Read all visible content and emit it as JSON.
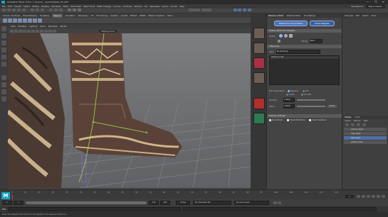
{
  "titlebar": {
    "title": "Autodesk Maya 2019: C:\\Users\\...\\scenes\\boot_fix.mb*",
    "controls": "— ❐ ✕"
  },
  "menubar": {
    "items": [
      "File",
      "Edit",
      "Create",
      "Select",
      "Modify",
      "Display",
      "Windows",
      "Mesh",
      "Edit Mesh",
      "Mesh Tools",
      "Mesh Display",
      "Curves",
      "Surfaces",
      "Deform",
      "UV",
      "Generate",
      "Cache",
      "Arnold",
      "Help"
    ],
    "workspace_label": "Workspace:",
    "workspace_value": "Maya Classic"
  },
  "shelftabs": [
    "Curves / Surfaces",
    "Poly Modeling",
    "Sculpting",
    "Rigging",
    "Animation",
    "Rendering",
    "FX",
    "FX Caching",
    "Custom",
    "Arnold",
    "Bifrost",
    "MASH",
    "Motion Graphics",
    "XGen"
  ],
  "viewport_menu": [
    "View",
    "Shading",
    "Lighting",
    "Show",
    "Renderer",
    "Panels"
  ],
  "viewport_field": "sRGB gamma",
  "refpanel": {
    "tabs": [
      "Reference Editor",
      "Attribute Editor",
      "Tool Settings",
      "Modeling Toolkit"
    ],
    "title": "Tool Settings",
    "button_left": "Reference Parameters",
    "button_right": "Paint Weights",
    "section_tool": "Artisan Paint Skin Weights",
    "profile_label": "Profile:",
    "mode_label": "Mode:",
    "mode_value": "Paint",
    "influences_header": "Influences",
    "sort_label": "Sort:",
    "sort_value": "By Hierarchy",
    "influence_list_label": "Influence List",
    "paint_op_label": "Paint Operation:",
    "op_replace": "Replace",
    "op_add": "Add",
    "op_scale": "Scale",
    "op_smooth": "Smooth",
    "opacity_label": "Opacity:",
    "opacity_value": "1.0000",
    "value_label": "Value:",
    "value_value": "0.0000",
    "flood_label": "Flood",
    "display_header": "Display Settings",
    "draw_brush": "Draw Brush",
    "show_wireframe": "Show Wireframe",
    "color_feedback": "Color Feedback"
  },
  "outliner": {
    "menu": [
      "Channels",
      "Edit",
      "Object",
      "Show"
    ],
    "tabs": [
      "Display",
      "Anim"
    ],
    "layer_menu": [
      "Layers",
      "Options",
      "Help"
    ],
    "layers": [
      "armour_layer",
      "rope_layer",
      "legs_layer",
      "yellow_mesh"
    ]
  },
  "timeslider": {
    "ticks": [
      "5",
      "10",
      "15",
      "20",
      "25",
      "30",
      "35",
      "40",
      "45",
      "50",
      "55",
      "60",
      "65",
      "70",
      "75",
      "80",
      "85",
      "90",
      "95",
      "100",
      "105",
      "110",
      "115",
      "120"
    ],
    "current_frame": "1"
  },
  "rangeslider": {
    "start": "1",
    "start2": "1",
    "end": "120",
    "end2": "200",
    "fps": "24 fps",
    "no_char": "No Character Set",
    "no_anim_layer": "No Anim Layer"
  },
  "cmdline": {
    "label": "MEL"
  },
  "helpline": "Paint Skin Weights Tool: Paint to add weight to the selected influence."
}
